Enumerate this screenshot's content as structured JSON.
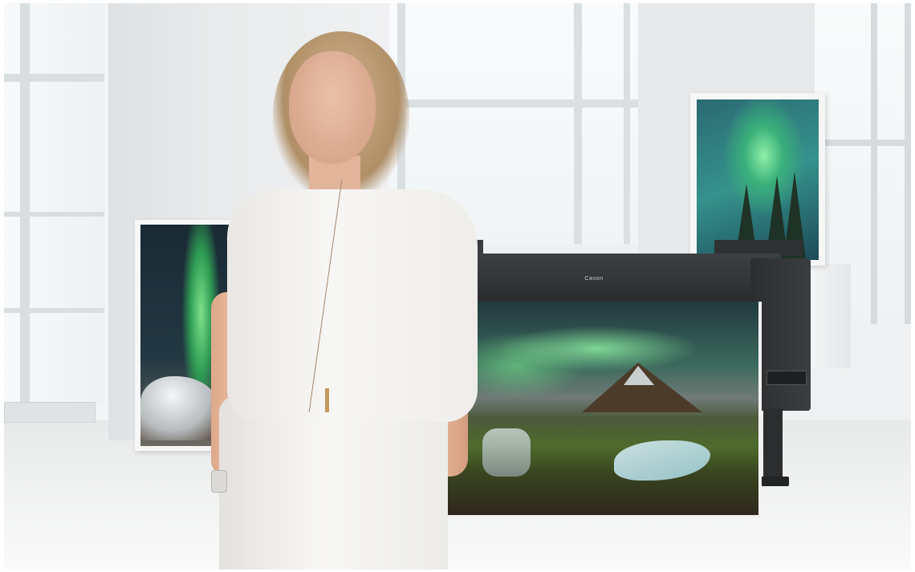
{
  "scene": {
    "description_alt": "",
    "printer_brand": "Canon"
  },
  "colors": {
    "room": "#eef0f1",
    "printer": "#2e3032",
    "shirt": "#f5f4f1",
    "aurora": "#5fd98a"
  }
}
